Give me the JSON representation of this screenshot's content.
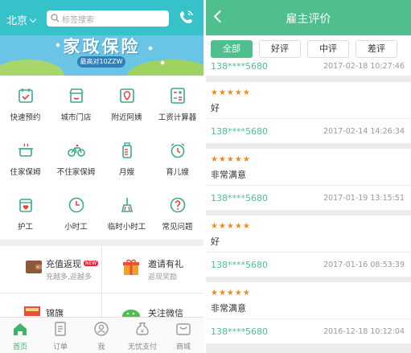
{
  "left": {
    "header": {
      "city": "北京",
      "search_placeholder": "标签搜索"
    },
    "banner": {
      "title": "家政保险",
      "subtitle": "最高对10ZZW"
    },
    "grid": [
      {
        "label": "快速预约",
        "icon": "calendar-icon"
      },
      {
        "label": "城市门店",
        "icon": "store-icon"
      },
      {
        "label": "附近阿姨",
        "icon": "map-pin-icon"
      },
      {
        "label": "工资计算器",
        "icon": "calculator-icon"
      },
      {
        "label": "住家保姆",
        "icon": "cooking-pot-icon"
      },
      {
        "label": "不住家保姆",
        "icon": "bicycle-icon"
      },
      {
        "label": "月嫂",
        "icon": "bottle-icon"
      },
      {
        "label": "育儿嫂",
        "icon": "alarm-clock-icon"
      },
      {
        "label": "护工",
        "icon": "medical-kit-icon"
      },
      {
        "label": "小时工",
        "icon": "clock-icon"
      },
      {
        "label": "临时小时工",
        "icon": "broom-icon"
      },
      {
        "label": "常见问题",
        "icon": "question-icon"
      }
    ],
    "promos": [
      {
        "title": "充值返现",
        "tag": "NEW",
        "sub": "充越多,返越多",
        "icon": "wallet-icon"
      },
      {
        "title": "邀请有礼",
        "sub": "返现奖励",
        "icon": "gift-icon"
      },
      {
        "title": "锦旗",
        "sub": "",
        "icon": "banner-flag-icon"
      },
      {
        "title": "关注微信",
        "sub": "",
        "icon": "wechat-icon"
      }
    ],
    "nav": [
      {
        "label": "首页",
        "icon": "home-icon",
        "active": true
      },
      {
        "label": "订单",
        "icon": "order-icon"
      },
      {
        "label": "我",
        "icon": "user-icon"
      },
      {
        "label": "无忧支付",
        "icon": "pay-icon"
      },
      {
        "label": "商城",
        "icon": "mall-icon"
      }
    ],
    "colors": {
      "header": "#36c2c9",
      "grid_icon": "#3aaa8a",
      "accent": "#3fb36b"
    }
  },
  "right": {
    "title": "雇主评价",
    "filters": [
      "全部",
      "好评",
      "中评",
      "差评"
    ],
    "selected_filter": "全部",
    "partial": {
      "user": "138****5680",
      "time": "2017-02-18 10:27:46"
    },
    "reviews": [
      {
        "stars": "★★★★★",
        "comment": "好",
        "user": "138****5680",
        "time": "2017-02-14 14:26:34"
      },
      {
        "stars": "★★★★★",
        "comment": "非常满意",
        "user": "138****5680",
        "time": "2017-01-19 13:15:51"
      },
      {
        "stars": "★★★★★",
        "comment": "好",
        "user": "138****5680",
        "time": "2017-01-16 08:53:39"
      },
      {
        "stars": "★★★★★",
        "comment": "非常满意",
        "user": "138****5680",
        "time": "2016-12-18 10:12:04"
      }
    ],
    "colors": {
      "header": "#4fc08d",
      "stars": "#f08a1c"
    }
  }
}
